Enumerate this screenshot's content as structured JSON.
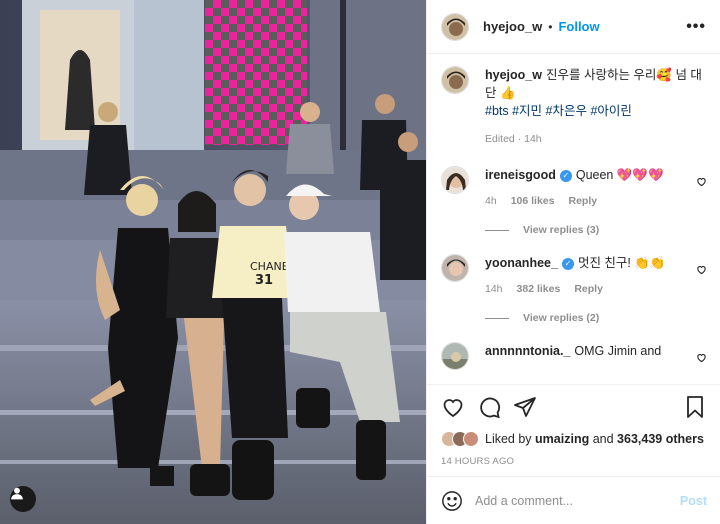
{
  "post": {
    "author": "hyejoo_w",
    "follow_label": "Follow",
    "separator": "•",
    "more_label": "•••",
    "caption_text": "진우를 사랑하는 우리🥰 넘 대단 👍",
    "hashtags": "#bts #지민 #차은우 #아이린",
    "caption_meta": "Edited · 14h"
  },
  "comments": [
    {
      "username": "ireneisgood",
      "verified": true,
      "text": "Queen 💖💖💖",
      "time": "4h",
      "likes": "106 likes",
      "reply": "Reply",
      "view_replies": "View replies (3)"
    },
    {
      "username": "yoonanhee_",
      "verified": true,
      "text": "멋진 친구! 👏👏",
      "time": "14h",
      "likes": "382 likes",
      "reply": "Reply",
      "view_replies": "View replies (2)"
    },
    {
      "username": "annnnntonia._",
      "verified": false,
      "text": "OMG Jimin and"
    }
  ],
  "likes": {
    "prefix": "Liked by",
    "user": "umaizing",
    "middle": "and",
    "count": "363,439 others"
  },
  "timestamp": "14 HOURS AGO",
  "add_comment": {
    "placeholder": "Add a comment...",
    "post_label": "Post"
  },
  "icons": [
    "heart-icon",
    "comment-icon",
    "share-icon",
    "bookmark-icon",
    "emoji-icon",
    "user-tag-icon"
  ],
  "colors": {
    "accent": "#0095f6",
    "verified": "#3897f0",
    "post_disabled": "#b2dffc",
    "muted": "#8e8e8e"
  }
}
